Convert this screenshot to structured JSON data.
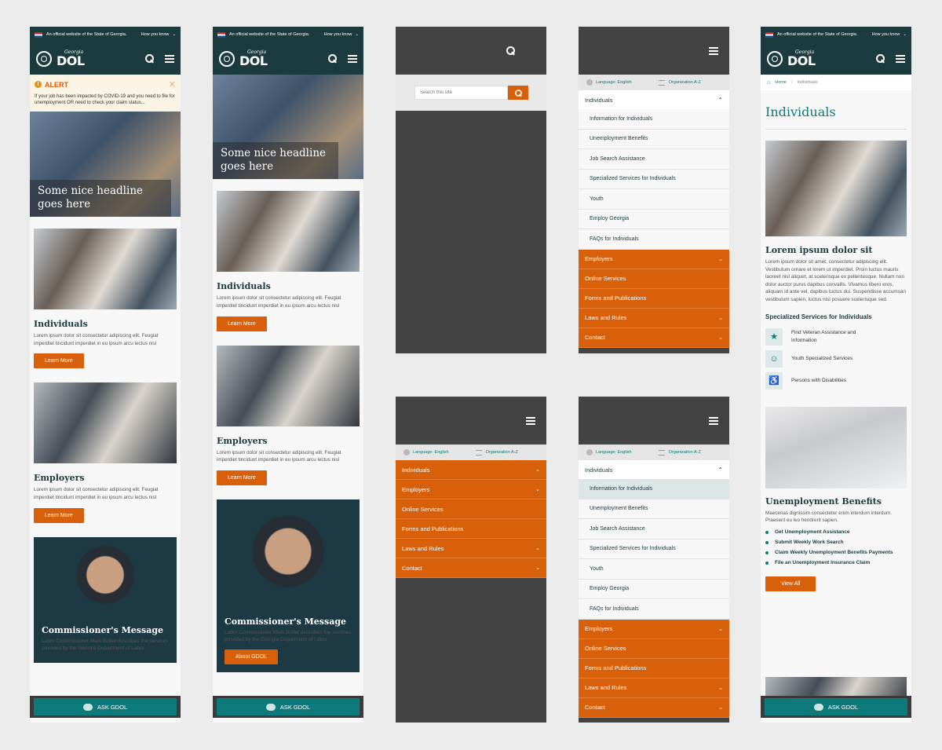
{
  "gov_banner": {
    "text": "An official website of the State of Georgia.",
    "how_you_know": "How you know",
    "chevron": "chevron-down-icon"
  },
  "logo": {
    "state": "Georgia",
    "agency": "DOL"
  },
  "alert": {
    "title": "ALERT",
    "text": "If your job has been impacted by COVID-19 and you need to file for unemployment OR need to check your claim status..."
  },
  "hero": {
    "headline": "Some nice headline goes here"
  },
  "cards": {
    "individuals": {
      "title": "Individuals",
      "text": "Lorem ipsum dolor sit consectetur adipiscing elit. Feugiat imperdiet tincidunt imperdiet in eu ipsum arcu lectus nisl",
      "button": "Learn More"
    },
    "employers": {
      "title": "Employers",
      "text": "Lorem ipsum dolor sit consectetur adipiscing elit. Feugiat imperdiet tincidunt imperdiet in eu ipsum arcu lectus nisl",
      "button": "Learn More"
    }
  },
  "commissioner": {
    "title": "Commissioner's Message",
    "text": "Labor Commissioner Mark Butler describes the services provided by the Georgia Department of Labor",
    "button": "About GDOL"
  },
  "ask": {
    "label": "ASK GDOL"
  },
  "search": {
    "placeholder": "Search this site"
  },
  "lang": {
    "language": "Language: English",
    "org": "Organization A-Z"
  },
  "menu": {
    "individuals": "Individuals",
    "employers": "Employers",
    "online": "Online Services",
    "forms": "Forms and Publications",
    "laws": "Laws and Rules",
    "contact": "Contact",
    "sub": [
      "Information for Individuals",
      "Unemployment Benefits",
      "Job Search Assistance",
      "Specialized Services for Individuals",
      "Youth",
      "Employ Georgia",
      "FAQs for Individuals"
    ]
  },
  "individuals_page": {
    "bread_home": "Home",
    "bread_current": "Individuals",
    "title": "Individuals",
    "sub_title": "Lorem ipsum dolor sit",
    "sub_text": "Lorem ipsum dolor sit amet, consectetur adipiscing elit. Vestibulum ornare et lorem ut imperdiet. Proin luctus mauris laoreet nisl aliquet, at scelerisque ex pellentesque. Nullam non dolor auctor purus dapibus convallis. Vivamus libero eros, aliquam id ante vel, dapibus luctus dui. Suspendisse accumsan vestibulum sapien, luctus nisl posuere scelerisque sed.",
    "services_title": "Specialized Services for Individuals",
    "services": [
      "Find Veteran Assistance and Information",
      "Youth Specialized Services",
      "Persons with Disabilities"
    ],
    "ub_title": "Unemployment Benefits",
    "ub_text": "Maecenas dignissim consectetur enim interdum interdum. Praesent eu leo hendrerit sapien.",
    "ub_links": [
      "Get Unemployment Assistance",
      "Submit Weekly Work Search",
      "Claim Weekly Unemployment Benefits Payments",
      "File an Unemployment Insurance Claim"
    ],
    "view_all": "View All"
  },
  "colors": {
    "teal_dark": "#1b3b3e",
    "teal": "#0d7b7c",
    "orange": "#d9600a"
  }
}
